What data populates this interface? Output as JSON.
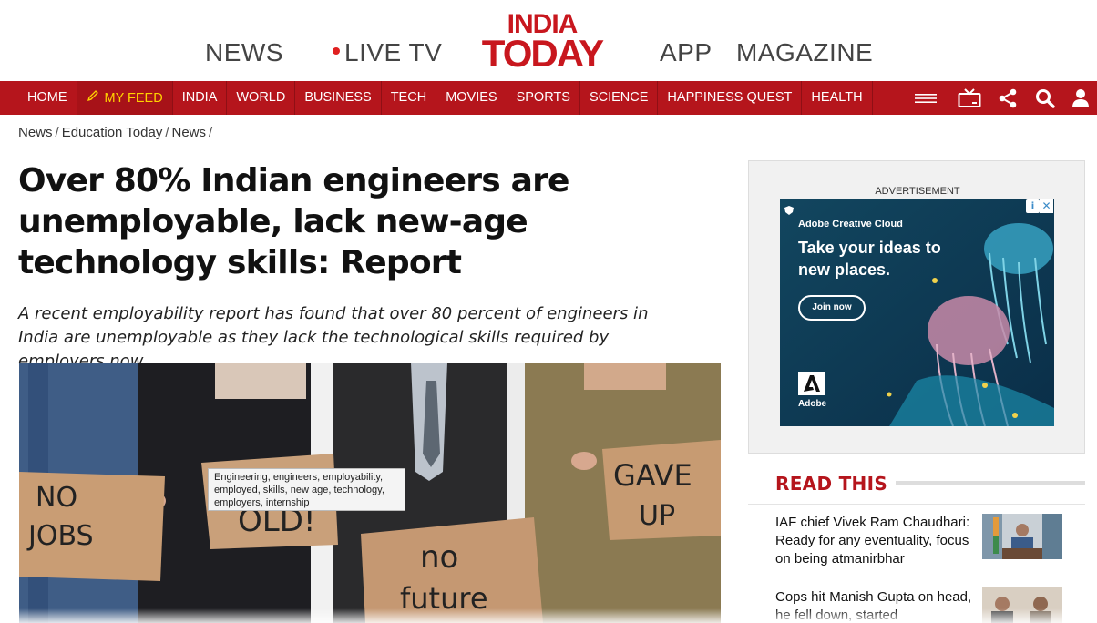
{
  "header": {
    "news": "NEWS",
    "live_tv": "LIVE TV",
    "logo_line1": "INDIA",
    "logo_line2": "TODAY",
    "app": "APP",
    "magazine": "MAGAZINE",
    "brand_color": "#c8171e"
  },
  "nav": {
    "background": "#b5151c",
    "items": [
      {
        "label": "HOME"
      },
      {
        "label": "MY FEED",
        "icon": "pencil-icon"
      },
      {
        "label": "INDIA"
      },
      {
        "label": "WORLD"
      },
      {
        "label": "BUSINESS"
      },
      {
        "label": "TECH"
      },
      {
        "label": "MOVIES"
      },
      {
        "label": "SPORTS"
      },
      {
        "label": "SCIENCE"
      },
      {
        "label": "HAPPINESS QUEST"
      },
      {
        "label": "HEALTH"
      }
    ],
    "icons": [
      "hamburger-menu-icon",
      "tv-icon",
      "share-icon",
      "search-icon",
      "user-icon"
    ]
  },
  "breadcrumb": [
    "News",
    "Education Today",
    "News"
  ],
  "article": {
    "headline": "Over 80% Indian engineers are unemployable, lack new-age technology skills: Report",
    "summary": "A recent employability report has found that over 80 percent of engineers in India are unemployable as they lack the technological skills required by employers now.",
    "image_tooltip": "Engineering, engineers, employability, employed, skills, new age, technology, employers, internship",
    "sign_texts": [
      "NO JOBS",
      "OLD!",
      "no future",
      "GAVE UP"
    ]
  },
  "sidebar": {
    "ad_label": "ADVERTISEMENT",
    "ad": {
      "brand": "Adobe Creative Cloud",
      "headline": "Take your ideas to new places.",
      "button": "Join now",
      "logo_name": "Adobe",
      "info": "i",
      "close": "✕"
    },
    "read_this_title": "READ THIS",
    "stories": [
      {
        "title": "IAF chief Vivek Ram Chaudhari: Ready for any eventuality, focus on being atmanirbhar"
      },
      {
        "title": "Cops hit Manish Gupta on head, he fell down, started"
      }
    ]
  }
}
